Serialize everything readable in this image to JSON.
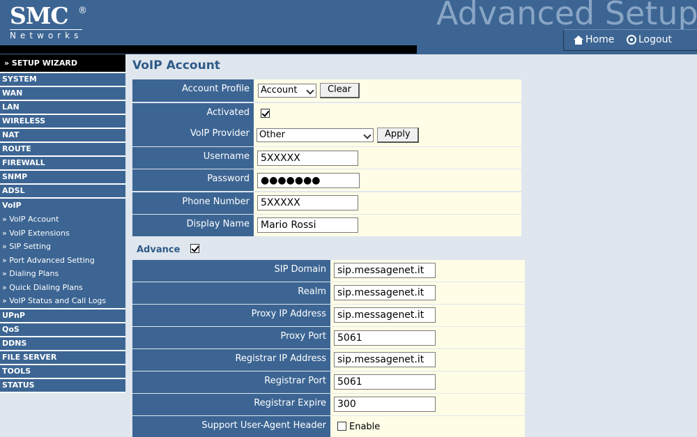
{
  "header": {
    "logo_main": "SMC",
    "logo_reg": "®",
    "logo_sub": "Networks",
    "title": "Advanced Setup",
    "home_label": "Home",
    "logout_label": "Logout"
  },
  "sidebar": {
    "wizard": "» SETUP WIZARD",
    "items_top": [
      "SYSTEM",
      "WAN",
      "LAN",
      "WIRELESS",
      "NAT",
      "ROUTE",
      "FIREWALL",
      "SNMP",
      "ADSL",
      "VoIP"
    ],
    "voip_sub": [
      "» VoIP Account",
      "» VoIP Extensions",
      "» SIP Setting",
      "» Port Advanced Setting",
      "» Dialing Plans",
      "» Quick Dialing Plans",
      "» VoIP Status and Call Logs"
    ],
    "items_bottom": [
      "UPnP",
      "QoS",
      "DDNS",
      "FILE SERVER",
      "TOOLS",
      "STATUS"
    ]
  },
  "main": {
    "title": "VoIP Account",
    "account_profile": {
      "label": "Account Profile",
      "value": "Account",
      "clear_label": "Clear"
    },
    "activated": {
      "label": "Activated",
      "checked": true
    },
    "voip_provider": {
      "label": "VoIP Provider",
      "value": "Other",
      "apply_label": "Apply"
    },
    "username": {
      "label": "Username",
      "value": "5XXXXX"
    },
    "password": {
      "label": "Password",
      "value": "●●●●●●●"
    },
    "phone_number": {
      "label": "Phone Number",
      "value": "5XXXXX"
    },
    "display_name": {
      "label": "Display Name",
      "value": "Mario Rossi"
    },
    "advance": {
      "label": "Advance",
      "checked": true
    },
    "sip_domain": {
      "label": "SIP Domain",
      "value": "sip.messagenet.it"
    },
    "realm": {
      "label": "Realm",
      "value": "sip.messagenet.it"
    },
    "proxy_ip": {
      "label": "Proxy IP Address",
      "value": "sip.messagenet.it"
    },
    "proxy_port": {
      "label": "Proxy Port",
      "value": "5061"
    },
    "registrar_ip": {
      "label": "Registrar IP Address",
      "value": "sip.messagenet.it"
    },
    "registrar_port": {
      "label": "Registrar Port",
      "value": "5061"
    },
    "registrar_expire": {
      "label": "Registrar Expire",
      "value": "300"
    },
    "user_agent": {
      "label": "Support User-Agent Header",
      "enable_label": "Enable",
      "checked": false
    }
  }
}
